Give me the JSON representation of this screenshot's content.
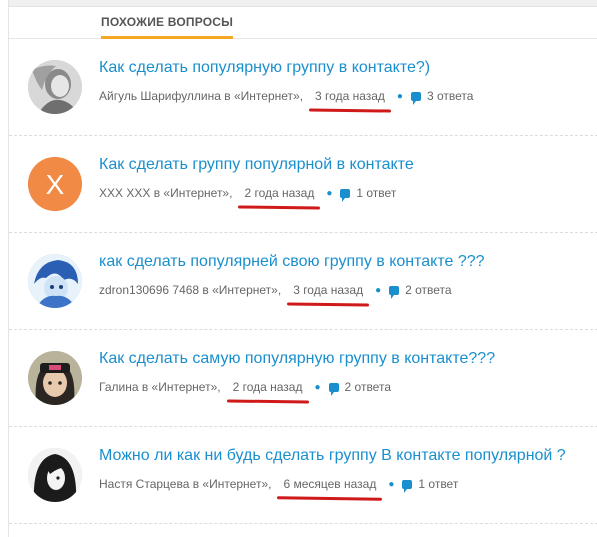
{
  "header": {
    "title": "ПОХОЖИЕ ВОПРОСЫ"
  },
  "questions": [
    {
      "title": "Как сделать популярную группу в контакте?)",
      "author": "Айгуль Шарифуллина в «Интернет»,",
      "time": "3 года назад",
      "answers": "3 ответа",
      "avatar": "avatar-gray-photo"
    },
    {
      "title": "Как сделать группу популярной в контакте",
      "author": "XXX XXX в «Интернет»,",
      "time": "2 года назад",
      "answers": "1 ответ",
      "avatar": "avatar-letter-x",
      "avatar_letter": "X",
      "avatar_color": "#f08a45"
    },
    {
      "title": "как сделать популярней свою группу в контакте ???",
      "author": "zdron130696 7468 в «Интернет»,",
      "time": "3 года назад",
      "answers": "2 ответа",
      "avatar": "avatar-blue-anime"
    },
    {
      "title": "Как сделать самую популярную группу в контакте???",
      "author": "Галина в «Интернет»,",
      "time": "2 года назад",
      "answers": "2 ответа",
      "avatar": "avatar-girl-cap"
    },
    {
      "title": "Можно ли как ни будь сделать группу В контакте популярной ?",
      "author": "Настя Старцева в «Интернет»,",
      "time": "6 месяцев назад",
      "answers": "1 ответ",
      "avatar": "avatar-dark-hair"
    }
  ],
  "colors": {
    "link": "#1a8fce",
    "accent_underline": "#f5a623",
    "annotation_red": "#d01a1a"
  }
}
